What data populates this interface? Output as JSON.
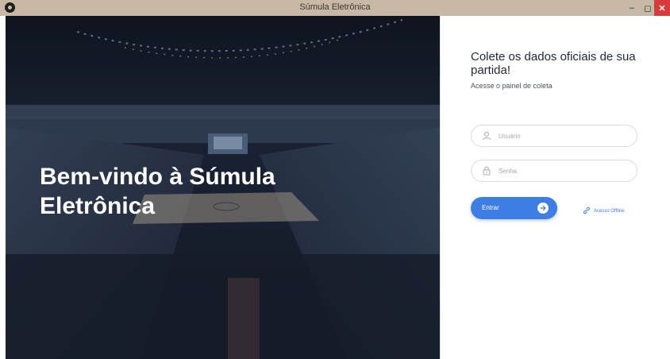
{
  "window": {
    "title": "Súmula Eletrônica",
    "minimize_label": "–",
    "maximize_label": "◻",
    "close_label": "✕"
  },
  "hero": {
    "title": "Bem-vindo à Súmula Eletrônica"
  },
  "panel": {
    "heading": "Colete os dados oficiais de sua partida!",
    "subheading": "Acesse o painel de coleta",
    "username": {
      "placeholder": "Usuário",
      "value": "",
      "icon": "user-icon"
    },
    "password": {
      "placeholder": "Senha",
      "value": "",
      "icon": "lock-icon"
    },
    "enter_button": {
      "label": "Entrar",
      "icon": "arrow-right-icon"
    },
    "offline_link": {
      "label": "Acesso Offline",
      "icon": "link-icon"
    }
  },
  "colors": {
    "accent": "#3d7de4",
    "titlebar": "#c8b8a6",
    "close": "#d83b3b",
    "hero_overlay": "#1b2433"
  }
}
